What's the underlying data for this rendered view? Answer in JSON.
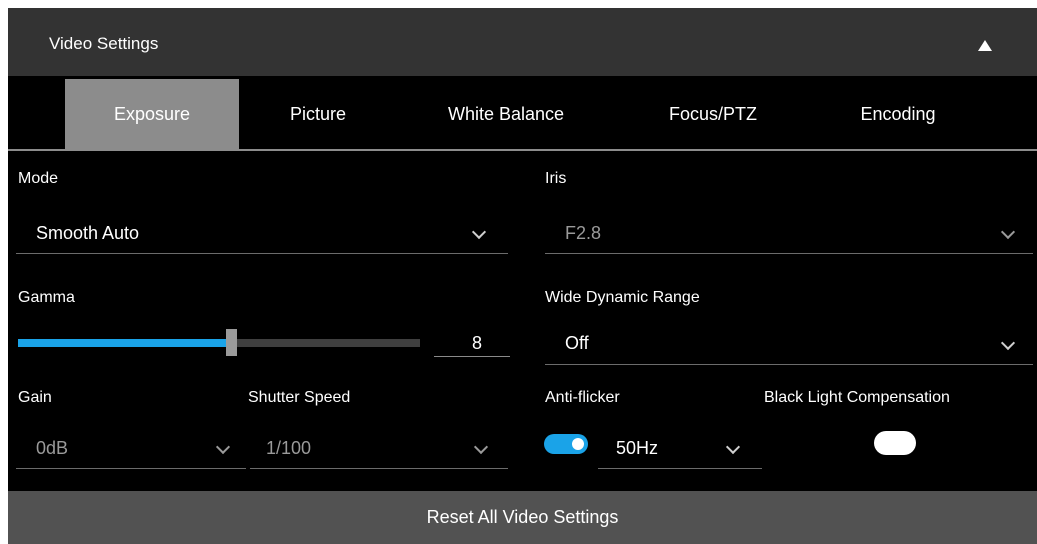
{
  "header": {
    "title": "Video Settings",
    "collapse_icon": "triangle-up-icon"
  },
  "tabs": [
    {
      "label": "Exposure",
      "active": true
    },
    {
      "label": "Picture",
      "active": false
    },
    {
      "label": "White Balance",
      "active": false
    },
    {
      "label": "Focus/PTZ",
      "active": false
    },
    {
      "label": "Encoding",
      "active": false
    }
  ],
  "mode": {
    "label": "Mode",
    "value": "Smooth Auto"
  },
  "iris": {
    "label": "Iris",
    "value": "F2.8",
    "disabled": true
  },
  "gamma": {
    "label": "Gamma",
    "value": "8",
    "slider_fraction": 0.53
  },
  "wdr": {
    "label": "Wide Dynamic Range",
    "value": "Off"
  },
  "gain": {
    "label": "Gain",
    "value": "0dB",
    "disabled": true
  },
  "shutter": {
    "label": "Shutter Speed",
    "value": "1/100",
    "disabled": true
  },
  "antiflicker": {
    "label": "Anti-flicker",
    "enabled": true,
    "value": "50Hz"
  },
  "blc": {
    "label": "Black Light Compensation",
    "enabled": false
  },
  "reset": {
    "label": "Reset All Video Settings"
  },
  "colors": {
    "accent": "#1aa3e8",
    "header_bg": "#333333",
    "active_tab": "#8c8c8c",
    "reset_bg": "#525252"
  }
}
